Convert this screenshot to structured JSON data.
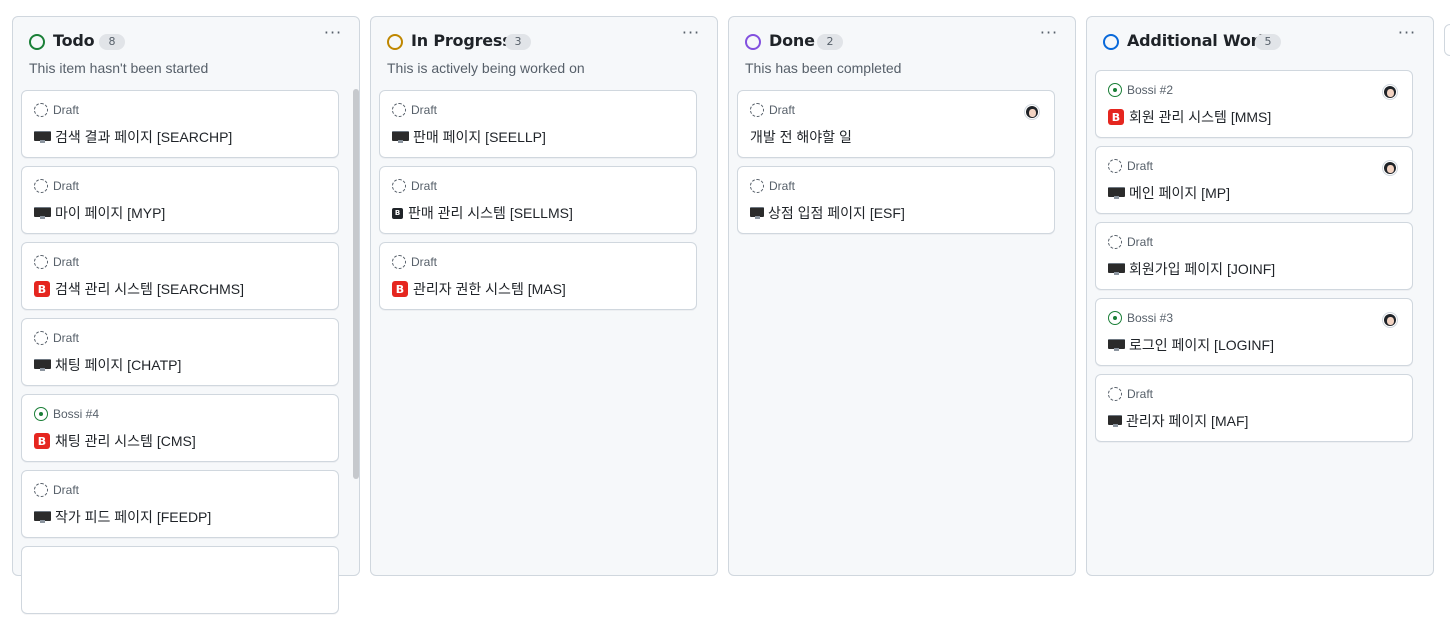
{
  "columns": [
    {
      "title": "Todo",
      "count": "8",
      "description": "This item hasn't been started",
      "status_color": "#1a7f37",
      "cards": [
        {
          "meta": "Draft",
          "icon": "monitor",
          "title": "검색 결과 페이지 [SEARCHP]",
          "avatar": false
        },
        {
          "meta": "Draft",
          "icon": "monitor",
          "title": "마이 페이지 [MYP]",
          "avatar": false
        },
        {
          "meta": "Draft",
          "icon": "b-red",
          "title": "검색 관리 시스템 [SEARCHMS]",
          "avatar": false
        },
        {
          "meta": "Draft",
          "icon": "monitor",
          "title": "채팅 페이지 [CHATP]",
          "avatar": false
        },
        {
          "meta": "Bossi #4",
          "icon": "b-red",
          "title": "채팅 관리 시스템 [CMS]",
          "avatar": false,
          "issue": true
        },
        {
          "meta": "Draft",
          "icon": "monitor",
          "title": "작가 피드 페이지 [FEEDP]",
          "avatar": false
        }
      ]
    },
    {
      "title": "In Progress",
      "count": "3",
      "description": "This is actively being worked on",
      "status_color": "#bf8700",
      "cards": [
        {
          "meta": "Draft",
          "icon": "monitor",
          "title": "판매 페이지 [SEELLP]",
          "avatar": false
        },
        {
          "meta": "Draft",
          "icon": "b-small",
          "title": "판매 관리 시스템 [SELLMS]",
          "avatar": false
        },
        {
          "meta": "Draft",
          "icon": "b-red",
          "title": "관리자 권한 시스템 [MAS]",
          "avatar": false
        }
      ]
    },
    {
      "title": "Done",
      "count": "2",
      "description": "This has been completed",
      "status_color": "#8250df",
      "cards": [
        {
          "meta": "Draft",
          "icon": "none",
          "title": "개발 전 해야할 일",
          "avatar": true
        },
        {
          "meta": "Draft",
          "icon": "monitor",
          "title": "상점 입점 페이지 [ESF]",
          "avatar": false
        }
      ]
    },
    {
      "title": "Additional Work",
      "count": "5",
      "description": "",
      "status_color": "#0969da",
      "cards": [
        {
          "meta": "Bossi #2",
          "icon": "b-red",
          "title": "회원 관리 시스템 [MMS]",
          "avatar": true,
          "issue": true
        },
        {
          "meta": "Draft",
          "icon": "monitor",
          "title": "메인 페이지 [MP]",
          "avatar": true
        },
        {
          "meta": "Draft",
          "icon": "monitor",
          "title": "회원가입 페이지 [JOINF]",
          "avatar": false
        },
        {
          "meta": "Bossi #3",
          "icon": "monitor",
          "title": "로그인 페이지 [LOGINF]",
          "avatar": true,
          "issue": true
        },
        {
          "meta": "Draft",
          "icon": "monitor",
          "title": "관리자 페이지 [MAF]",
          "avatar": false
        }
      ]
    }
  ],
  "more_label": "···"
}
